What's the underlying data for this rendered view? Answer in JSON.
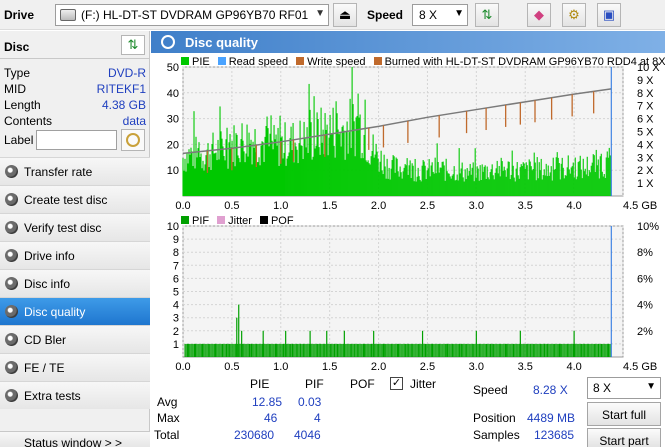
{
  "toolbar": {
    "drive_label": "Drive",
    "drive_value": "(F:)  HL-DT-ST DVDRAM GP96YB70 RF01",
    "speed_label": "Speed",
    "speed_value": "8 X"
  },
  "disc": {
    "title": "Disc",
    "rows": [
      {
        "key": "Type",
        "value": "DVD-R"
      },
      {
        "key": "MID",
        "value": "RITEKF1"
      },
      {
        "key": "Length",
        "value": "4.38 GB"
      },
      {
        "key": "Contents",
        "value": "data"
      }
    ],
    "label_key": "Label",
    "label_value": ""
  },
  "nav": {
    "items": [
      {
        "label": "Transfer rate",
        "active": false
      },
      {
        "label": "Create test disc",
        "active": false
      },
      {
        "label": "Verify test disc",
        "active": false
      },
      {
        "label": "Drive info",
        "active": false
      },
      {
        "label": "Disc info",
        "active": false
      },
      {
        "label": "Disc quality",
        "active": true
      },
      {
        "label": "CD Bler",
        "active": false
      },
      {
        "label": "FE / TE",
        "active": false
      },
      {
        "label": "Extra tests",
        "active": false
      }
    ],
    "status_window": "Status window > >"
  },
  "main": {
    "title": "Disc quality"
  },
  "colors": {
    "pie": "#00c800",
    "read_speed": "#4aa3ff",
    "write_speed": "#c06a2c",
    "burned": "#c06a2c",
    "pif": "#00a000",
    "jitter": "#e0a0d0",
    "pof": "#000000",
    "limit": "#1e6fe0"
  },
  "chart_data": [
    {
      "type": "area",
      "legend": [
        "PIE",
        "Read speed",
        "Write speed",
        "Burned with HL-DT-ST DVDRAM GP96YB70 RDD4 at 8X"
      ],
      "x_ticks": [
        "0.0",
        "0.5",
        "1.0",
        "1.5",
        "2.0",
        "2.5",
        "3.0",
        "3.5",
        "4.0",
        "4.5 GB"
      ],
      "y_left_ticks": [
        "10",
        "20",
        "30",
        "40",
        "50"
      ],
      "y_right_ticks": [
        "1 X",
        "2 X",
        "3 X",
        "4 X",
        "5 X",
        "6 X",
        "7 X",
        "8 X",
        "9 X",
        "10 X"
      ],
      "xlim": [
        0,
        4.5
      ],
      "ylim": [
        0,
        50
      ],
      "y2lim": [
        0,
        10
      ],
      "grid": true,
      "series": [
        {
          "name": "PIE",
          "x": [
            0.0,
            0.1,
            0.2,
            0.3,
            0.4,
            0.5,
            0.6,
            0.7,
            0.8,
            0.9,
            1.0,
            1.1,
            1.2,
            1.3,
            1.4,
            1.5,
            1.6,
            1.7,
            1.8,
            1.9,
            2.0,
            2.1,
            2.2,
            2.3,
            2.4,
            2.5,
            2.6,
            2.7,
            2.8,
            2.9,
            3.0,
            3.1,
            3.2,
            3.3,
            3.4,
            3.5,
            3.6,
            3.7,
            3.8,
            3.9,
            4.0,
            4.1,
            4.2,
            4.3,
            4.38
          ],
          "values": [
            18,
            20,
            19,
            21,
            22,
            24,
            26,
            27,
            25,
            23,
            24,
            25,
            26,
            27,
            29,
            31,
            30,
            32,
            34,
            24,
            18,
            14,
            13,
            13,
            12,
            12,
            13,
            12,
            12,
            11,
            11,
            12,
            12,
            13,
            12,
            12,
            13,
            12,
            13,
            13,
            14,
            13,
            15,
            15,
            16
          ]
        },
        {
          "name": "Read speed",
          "x": [
            0.0,
            0.5,
            1.0,
            1.5,
            2.0,
            2.5,
            3.0,
            3.5,
            4.0,
            4.38
          ],
          "values": [
            3.3,
            3.7,
            4.2,
            4.8,
            5.4,
            6.1,
            6.7,
            7.3,
            7.9,
            8.3
          ]
        }
      ],
      "read_speed_dips": [
        0.25,
        0.5,
        0.75,
        1.0,
        1.13,
        1.45,
        1.9,
        2.05,
        2.3,
        2.62,
        2.9,
        3.1,
        3.3,
        3.45,
        3.6,
        3.77,
        3.98,
        4.2
      ]
    },
    {
      "type": "bar",
      "legend": [
        "PIF",
        "Jitter",
        "POF"
      ],
      "x_ticks": [
        "0.0",
        "0.5",
        "1.0",
        "1.5",
        "2.0",
        "2.5",
        "3.0",
        "3.5",
        "4.0",
        "4.5 GB"
      ],
      "y_left_ticks": [
        "1",
        "2",
        "3",
        "4",
        "5",
        "6",
        "7",
        "8",
        "9",
        "10"
      ],
      "y_right_ticks": [
        "2%",
        "4%",
        "6%",
        "8%",
        "10%"
      ],
      "xlim": [
        0,
        4.5
      ],
      "ylim": [
        0,
        10
      ],
      "grid": true,
      "series": [
        {
          "name": "PIF",
          "x": [
            0.05,
            0.12,
            0.2,
            0.33,
            0.45,
            0.55,
            0.57,
            0.6,
            0.7,
            0.82,
            0.95,
            1.05,
            1.12,
            1.2,
            1.3,
            1.4,
            1.47,
            1.55,
            1.65,
            1.75,
            1.85,
            1.95,
            2.05,
            2.2,
            2.3,
            2.45,
            2.55,
            2.7,
            2.85,
            3.0,
            3.15,
            3.3,
            3.45,
            3.55,
            3.7,
            3.85,
            4.0,
            4.1,
            4.25,
            4.35
          ],
          "values": [
            1,
            1,
            1,
            1,
            1,
            3,
            4,
            2,
            1,
            2,
            1,
            2,
            1,
            1,
            2,
            1,
            2,
            1,
            2,
            1,
            1,
            2,
            1,
            1,
            1,
            2,
            1,
            1,
            1,
            2,
            1,
            1,
            2,
            1,
            1,
            1,
            2,
            1,
            1,
            1
          ]
        }
      ]
    }
  ],
  "stats": {
    "headers": [
      "PIE",
      "PIF",
      "POF"
    ],
    "jitter_label": "Jitter",
    "jitter_checked": "✓",
    "rows": [
      {
        "label": "Avg",
        "pie": "12.85",
        "pif": "0.03"
      },
      {
        "label": "Max",
        "pie": "46",
        "pif": "4"
      },
      {
        "label": "Total",
        "pie": "230680",
        "pif": "4046"
      }
    ],
    "speed_label": "Speed",
    "speed_value": "8.28 X",
    "speed_select": "8 X",
    "position_label": "Position",
    "position_value": "4489 MB",
    "samples_label": "Samples",
    "samples_value": "123685",
    "start_full": "Start full",
    "start_part": "Start part"
  }
}
